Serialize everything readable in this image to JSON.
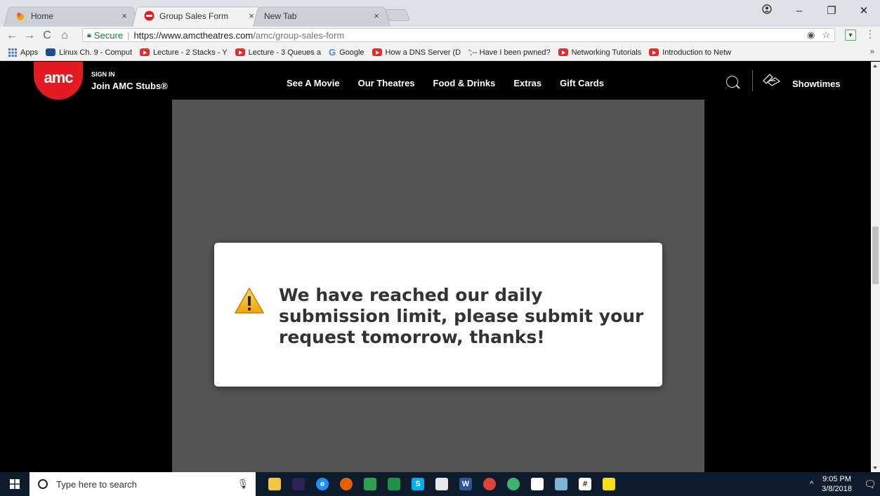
{
  "browser": {
    "tabs": [
      {
        "title": "Home",
        "favicon": "flame-icon",
        "active": false
      },
      {
        "title": "Group Sales Form",
        "favicon": "amc-icon",
        "active": true
      },
      {
        "title": "New Tab",
        "favicon": "",
        "active": false
      }
    ],
    "close_glyph": "×",
    "address": {
      "secure_label": "Secure",
      "separator": "|",
      "url_host": "https://www.amctheatres.com",
      "url_path": "/amc/group-sales-form"
    },
    "bookmarks": [
      {
        "label": "Apps",
        "icon": "apps-grid-icon"
      },
      {
        "label": "Linux Ch. 9 - Comput",
        "icon": "monitor-icon"
      },
      {
        "label": "Lecture - 2 Stacks - Y",
        "icon": "youtube-icon"
      },
      {
        "label": "Lecture - 3 Queues a",
        "icon": "youtube-icon"
      },
      {
        "label": "Google",
        "icon": "google-icon"
      },
      {
        "label": "How a DNS Server (D",
        "icon": "youtube-icon"
      },
      {
        "label": "';-- Have I been pwned?",
        "icon": "pwned-icon"
      },
      {
        "label": "Networking Tutorials",
        "icon": "youtube-icon"
      },
      {
        "label": "Introduction to Netw",
        "icon": "youtube-icon"
      }
    ],
    "bookmarks_overflow": "»"
  },
  "site": {
    "logo_text": "amc",
    "sign_in": "SIGN IN",
    "join": "Join AMC Stubs®",
    "nav": [
      "See A Movie",
      "Our Theatres",
      "Food & Drinks",
      "Extras",
      "Gift Cards"
    ],
    "showtimes": "Showtimes",
    "brand_red": "#e31b23"
  },
  "modal": {
    "message": "We have reached our daily submission limit, please submit your request tomorrow, thanks!",
    "icon": "warning-icon"
  },
  "taskbar": {
    "search_placeholder": "Type here to search",
    "apps": [
      {
        "name": "file-explorer-icon",
        "color": "#f4c542",
        "glyph": ""
      },
      {
        "name": "eclipse-icon",
        "color": "#2c2255",
        "glyph": ""
      },
      {
        "name": "edge-icon",
        "color": "#1e90ff",
        "glyph": "e"
      },
      {
        "name": "firefox-icon",
        "color": "#e66000",
        "glyph": ""
      },
      {
        "name": "notes-icon",
        "color": "#2e9e4f",
        "glyph": ""
      },
      {
        "name": "photos-icon",
        "color": "#1f8f4a",
        "glyph": ""
      },
      {
        "name": "skype-icon",
        "color": "#00aff0",
        "glyph": "S"
      },
      {
        "name": "file-icon",
        "color": "#e8e8e8",
        "glyph": ""
      },
      {
        "name": "word-icon",
        "color": "#2b579a",
        "glyph": "W"
      },
      {
        "name": "chrome-icon",
        "color": "#db4437",
        "glyph": ""
      },
      {
        "name": "atom-icon",
        "color": "#3cb371",
        "glyph": ""
      },
      {
        "name": "mail-icon",
        "color": "#ffffff",
        "glyph": ""
      },
      {
        "name": "paint-icon",
        "color": "#7fb3d5",
        "glyph": ""
      },
      {
        "name": "slack-icon",
        "color": "#ffffff",
        "glyph": "#"
      },
      {
        "name": "git-icon",
        "color": "#f7df1e",
        "glyph": ""
      }
    ],
    "time": "9:05 PM",
    "date": "3/8/2018"
  }
}
